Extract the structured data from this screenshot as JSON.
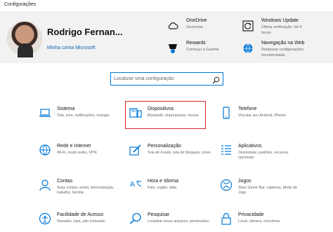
{
  "window": {
    "title": "Configurações"
  },
  "user": {
    "name": "Rodrigo Fernan...",
    "account_link": "Minha conta Microsoft"
  },
  "header_items": [
    {
      "title": "OneDrive",
      "subtitle": "Gerenciar"
    },
    {
      "title": "Rewards",
      "subtitle": "Começar a Ganhar"
    },
    {
      "title": "Windows Update",
      "subtitle": "Última verificação: há 4 horas"
    },
    {
      "title": "Navegação na Web",
      "subtitle": "Restaurar configurações recomendada"
    }
  ],
  "search": {
    "placeholder": "Localizar uma configuração"
  },
  "tiles": [
    {
      "title": "Sistema",
      "subtitle": "Tela, som, notificações, energia",
      "icon": "laptop-icon"
    },
    {
      "title": "Dispositivos",
      "subtitle": "Bluetooth, impressoras, mouse",
      "icon": "devices-icon"
    },
    {
      "title": "Telefone",
      "subtitle": "Vincular seu Android, iPhone",
      "icon": "phone-icon"
    },
    {
      "title": "Rede e Internet",
      "subtitle": "Wi-Fi, modo avião, VPN",
      "icon": "globe-icon"
    },
    {
      "title": "Personalização",
      "subtitle": "Tela de Fundo, tela de bloqueio, cores",
      "icon": "paintbrush-icon"
    },
    {
      "title": "Aplicativos",
      "subtitle": "Desinstalar, padrões, recursos opcionais",
      "icon": "apps-icon"
    },
    {
      "title": "Contas",
      "subtitle": "Suas contas, email, sincronização, trabalho, família",
      "icon": "person-icon"
    },
    {
      "title": "Hora e Idioma",
      "subtitle": "Fala, região, data",
      "icon": "time-language-icon"
    },
    {
      "title": "Jogos",
      "subtitle": "Xbox Game Bar, capturas, Modo de Jogo",
      "icon": "xbox-icon"
    },
    {
      "title": "Facilidade de Acesso",
      "subtitle": "Narrador, lupa, alto contraste",
      "icon": "accessibility-icon"
    },
    {
      "title": "Pesquisar",
      "subtitle": "Localizar meus arquivos, permissões",
      "icon": "search-icon"
    },
    {
      "title": "Privacidade",
      "subtitle": "Local, câmera, microfone",
      "icon": "lock-icon"
    }
  ],
  "colors": {
    "accent": "#0078d7",
    "highlight": "#d9262b",
    "header_bg": "#f2f2f2"
  }
}
